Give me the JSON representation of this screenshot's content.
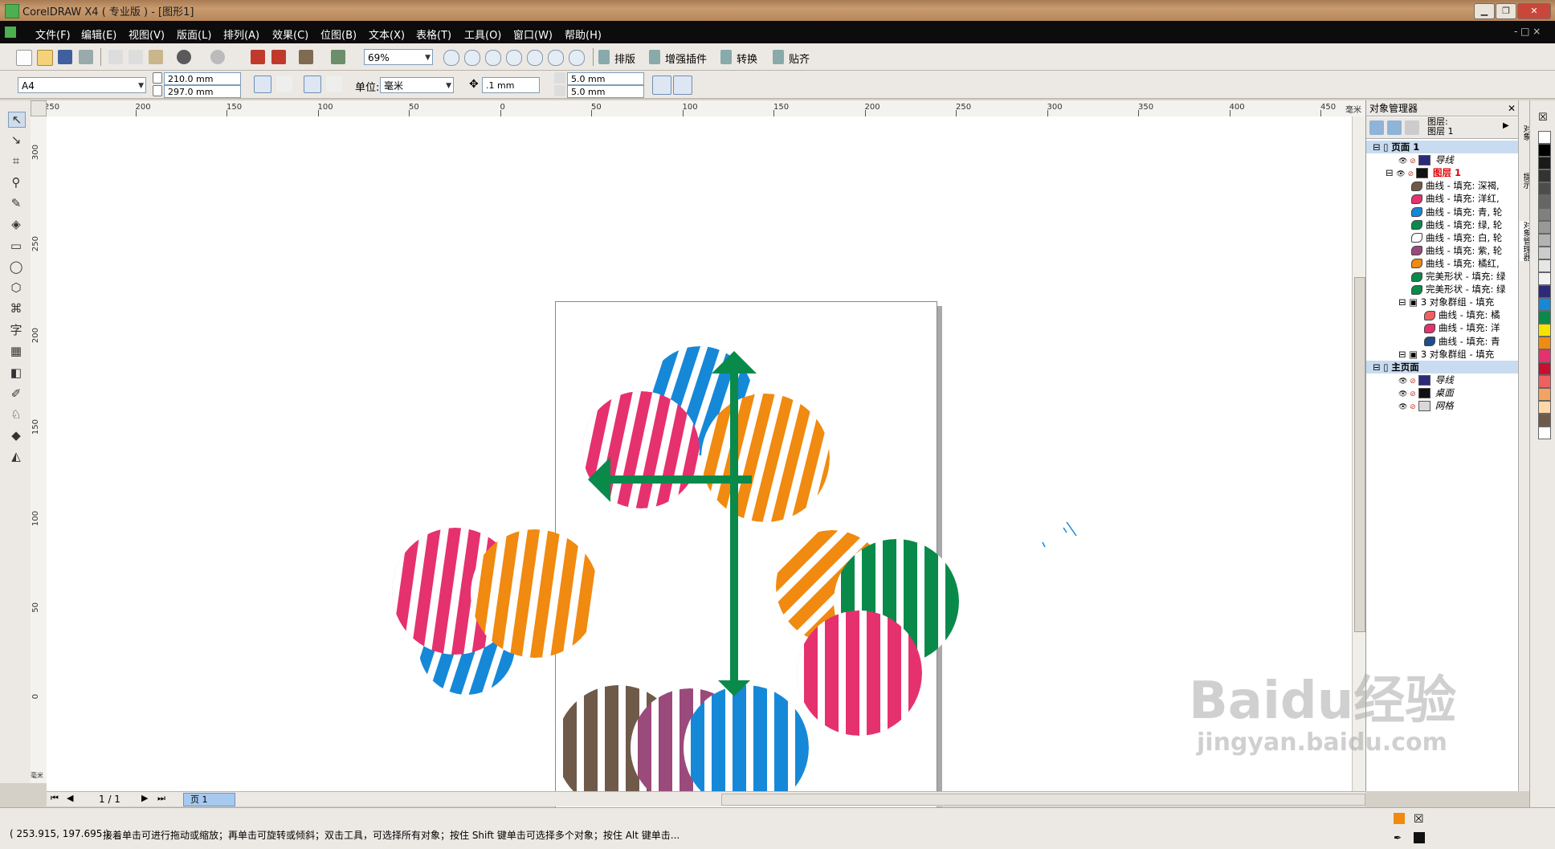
{
  "window": {
    "title": "CorelDRAW X4 ( 专业版 ) - [图形1]",
    "minimize": "▁",
    "restore": "❐",
    "close": "✕"
  },
  "menu": {
    "items": [
      "文件(F)",
      "编辑(E)",
      "视图(V)",
      "版面(L)",
      "排列(A)",
      "效果(C)",
      "位图(B)",
      "文本(X)",
      "表格(T)",
      "工具(O)",
      "窗口(W)",
      "帮助(H)"
    ],
    "doc_controls": "-  □  ×"
  },
  "toolbar": {
    "zoom": "69%",
    "paiban": "排版",
    "zengqiang": "增强插件",
    "zhuanhuan": "转换",
    "tieqi": "贴齐"
  },
  "property_bar": {
    "paper": "A4",
    "width": "210.0 mm",
    "height": "297.0 mm",
    "unit_label": "单位:",
    "unit": "毫米",
    "nudge": ".1 mm",
    "dup_x": "5.0 mm",
    "dup_y": "5.0 mm"
  },
  "hruler_ticks": [
    "250",
    "200",
    "150",
    "100",
    "50",
    "0",
    "50",
    "100",
    "150",
    "200",
    "250",
    "300",
    "350",
    "400",
    "450"
  ],
  "hruler_unit": "毫米",
  "vruler_ticks": [
    "300",
    "250",
    "200",
    "150",
    "100",
    "50",
    "0"
  ],
  "vruler_unit": "毫米",
  "page_nav": {
    "count": "1 / 1",
    "tab": "页 1"
  },
  "object_manager": {
    "title": "对象管理器",
    "layer_line1": "图层:",
    "layer_line2": "图层 1",
    "rows": [
      {
        "indent": 0,
        "kind": "page",
        "label": "页面 1",
        "color": ""
      },
      {
        "indent": 2,
        "kind": "layer",
        "label": "导线",
        "color": "#2e2a7a"
      },
      {
        "indent": 1,
        "kind": "layer-active",
        "label": "图层 1",
        "color": "#111111"
      },
      {
        "indent": 3,
        "kind": "item",
        "label": "曲线 - 填充: 深褐,",
        "color": "#6f5a4a"
      },
      {
        "indent": 3,
        "kind": "item",
        "label": "曲线 - 填充: 洋红,",
        "color": "#e6316f"
      },
      {
        "indent": 3,
        "kind": "item",
        "label": "曲线 - 填充: 青, 轮",
        "color": "#1688d8"
      },
      {
        "indent": 3,
        "kind": "item",
        "label": "曲线 - 填充: 绿, 轮",
        "color": "#0a8a4a"
      },
      {
        "indent": 3,
        "kind": "item",
        "label": "曲线 - 填充: 白, 轮",
        "color": "#ffffff"
      },
      {
        "indent": 3,
        "kind": "item",
        "label": "曲线 - 填充: 紫, 轮",
        "color": "#9b4a7c"
      },
      {
        "indent": 3,
        "kind": "item",
        "label": "曲线 - 填充: 橘红,",
        "color": "#f08a10"
      },
      {
        "indent": 3,
        "kind": "item",
        "label": "完美形状 - 填充: 绿",
        "color": "#0a8a4a"
      },
      {
        "indent": 3,
        "kind": "item",
        "label": "完美形状 - 填充: 绿",
        "color": "#0a8a4a"
      },
      {
        "indent": 2,
        "kind": "group",
        "label": "3 对象群组 - 填充",
        "color": ""
      },
      {
        "indent": 4,
        "kind": "item",
        "label": "曲线 - 填充: 橘",
        "color": "#f06060"
      },
      {
        "indent": 4,
        "kind": "item",
        "label": "曲线 - 填充: 洋",
        "color": "#e6316f"
      },
      {
        "indent": 4,
        "kind": "item",
        "label": "曲线 - 填充: 青",
        "color": "#1d4d8a"
      },
      {
        "indent": 2,
        "kind": "group",
        "label": "3 对象群组 - 填充",
        "color": ""
      },
      {
        "indent": 0,
        "kind": "page",
        "label": "主页面",
        "color": ""
      },
      {
        "indent": 2,
        "kind": "layer",
        "label": "导线",
        "color": "#2e2a7a"
      },
      {
        "indent": 2,
        "kind": "layer",
        "label": "桌面",
        "color": "#111111"
      },
      {
        "indent": 2,
        "kind": "layer",
        "label": "网格",
        "color": "#d8d8d8"
      }
    ]
  },
  "docker_tabs": [
    "对象",
    "提示",
    "对象管理器"
  ],
  "palette": [
    "#ffffff",
    "#000000",
    "#1a1a1a",
    "#333333",
    "#4d4d4d",
    "#666666",
    "#808080",
    "#999999",
    "#b3b3b3",
    "#cccccc",
    "#e6e6e6",
    "#f2f2f2",
    "#2e2a7a",
    "#1688d8",
    "#0a8a4a",
    "#f7e300",
    "#f08a10",
    "#e6316f",
    "#c8102e",
    "#f06060",
    "#f4a261",
    "#ffd7a8",
    "#6f5a4a",
    "#ffffff"
  ],
  "status": {
    "coords": "( 253.915, 197.695 )",
    "hint": "接着单击可进行拖动或缩放；再单击可旋转或倾斜；双击工具，可选择所有对象；按住 Shift 键单击可选择多个对象；按住 Alt 键单击..."
  },
  "watermark": {
    "brand": "Baidu经验",
    "url": "jingyan.baidu.com"
  },
  "art_colors": {
    "blue": "#1688d8",
    "pink": "#e6316f",
    "orange": "#f08a10",
    "green": "#0a8a4a",
    "brown": "#6f5a4a",
    "purple": "#9b4a7c"
  }
}
